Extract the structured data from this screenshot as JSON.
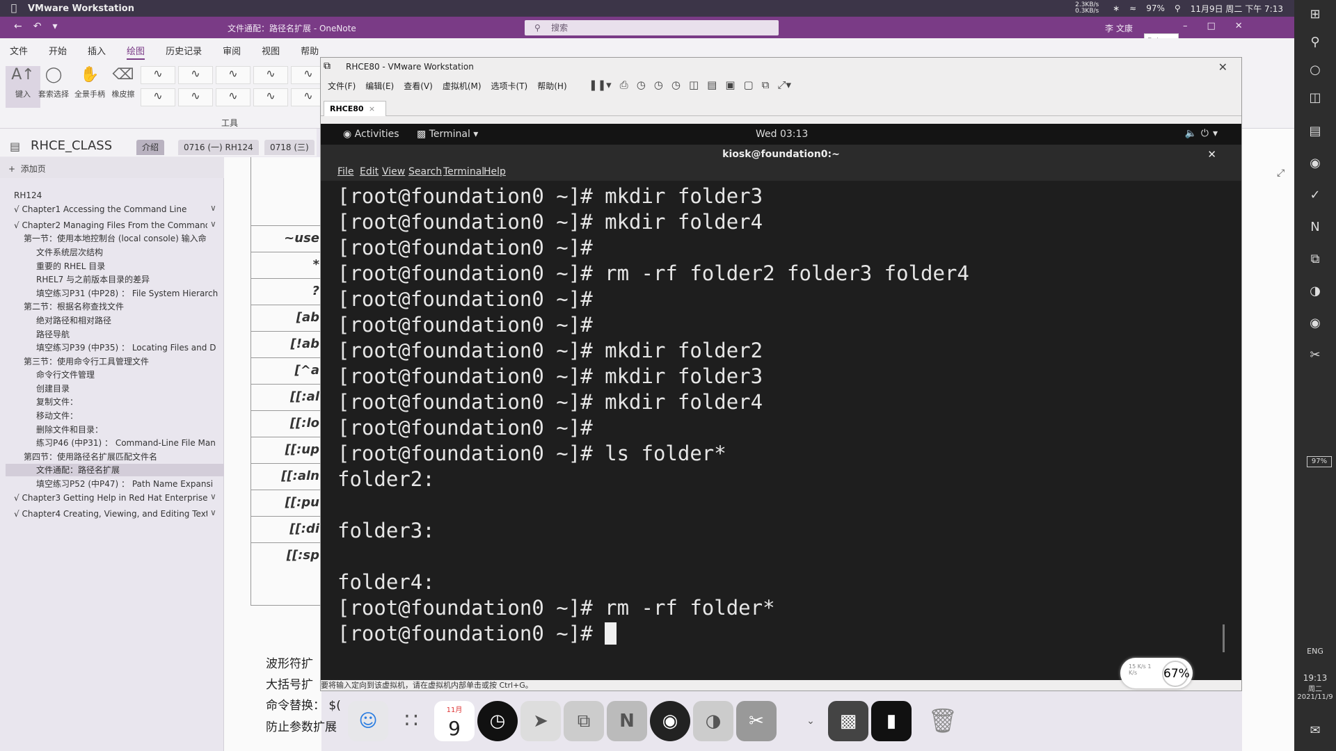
{
  "mac_menubar": {
    "app_name": "VMware Workstation",
    "right_items": [
      "2.3KB/s 0.3KB/s",
      "97%",
      "11月9日 周二 下午 7:13"
    ]
  },
  "onenote": {
    "window_title": "文件通配：路径名扩展 - OneNote",
    "search_placeholder": "搜索",
    "user": "李 文康",
    "ribbon_tabs": [
      "文件",
      "开始",
      "插入",
      "绘图",
      "历史记录",
      "审阅",
      "视图",
      "帮助"
    ],
    "active_tab": "绘图",
    "tools": [
      {
        "label": "键入",
        "icon": "cursor-icon"
      },
      {
        "label": "套索选择",
        "icon": "lasso-icon"
      },
      {
        "label": "全景手柄",
        "icon": "hand-icon"
      },
      {
        "label": "橡皮擦",
        "icon": "eraser-icon"
      }
    ],
    "tools_group_label": "工具",
    "notebook_name": "RHCE_CLASS",
    "sections": [
      "介绍",
      "0716 (一) RH124",
      "0718 (三)"
    ],
    "add_page": "添加页",
    "pages": [
      {
        "text": "RH124",
        "indent": 0
      },
      {
        "text": "√ Chapter1 Accessing the Command Line",
        "indent": 0,
        "chev": true
      },
      {
        "text": "√ Chapter2 Managing Files From the Command Li",
        "indent": 0,
        "chev": true
      },
      {
        "text": "第一节：使用本地控制台 (local console) 输入命",
        "indent": 1
      },
      {
        "text": "文件系统层次结构",
        "indent": 2
      },
      {
        "text": "重要的 RHEL 目录",
        "indent": 2
      },
      {
        "text": "RHEL7 与之前版本目录的差异",
        "indent": 2
      },
      {
        "text": "填空练习P31 (中P28) ： File System Hierarch",
        "indent": 2
      },
      {
        "text": "第二节：根据名称查找文件",
        "indent": 1
      },
      {
        "text": "绝对路径和相对路径",
        "indent": 2
      },
      {
        "text": "路径导航",
        "indent": 2
      },
      {
        "text": "填空练习P39 (中P35) ： Locating Files and D",
        "indent": 2
      },
      {
        "text": "第三节：使用命令行工具管理文件",
        "indent": 1
      },
      {
        "text": "命令行文件管理",
        "indent": 2
      },
      {
        "text": "创建目录",
        "indent": 2
      },
      {
        "text": "复制文件：",
        "indent": 2
      },
      {
        "text": "移动文件：",
        "indent": 2
      },
      {
        "text": "删除文件和目录：",
        "indent": 2
      },
      {
        "text": "练习P46 (中P31) ： Command-Line File Man",
        "indent": 2
      },
      {
        "text": "第四节：使用路径名扩展匹配文件名",
        "indent": 1
      },
      {
        "text": "文件通配：路径名扩展",
        "indent": 2,
        "selected": true
      },
      {
        "text": "填空练习P52 (中P47) ： Path Name Expansi",
        "indent": 2
      },
      {
        "text": "√ Chapter3 Getting Help in Red Hat Enterprise",
        "indent": 0,
        "chev": true
      },
      {
        "text": "√ Chapter4 Creating, Viewing, and Editing Text",
        "indent": 0,
        "chev": true
      }
    ],
    "table_cells": [
      "~use",
      "*",
      "?",
      "[ab",
      "[!ab",
      "[^a",
      "[[:al",
      "[[:lo",
      "[[:up",
      "[[:aln",
      "[[:pu",
      "[[:di",
      "[[:sp"
    ],
    "notes": [
      "波形符扩",
      "大括号扩",
      "命令替换：  $(",
      "防止参数扩展"
    ]
  },
  "popup": {
    "top_text": "Poi...",
    "button": "开始"
  },
  "vmware": {
    "title": "RHCE80 - VMware Workstation",
    "menu": [
      "文件(F)",
      "编辑(E)",
      "查看(V)",
      "虚拟机(M)",
      "选项卡(T)",
      "帮助(H)"
    ],
    "tab": "RHCE80",
    "status": "要将输入定向到该虚拟机，请在虚拟机内部单击或按 Ctrl+G。",
    "zoom": "67%",
    "net_speed": "15 K/s 1 K/s"
  },
  "guest": {
    "activities": "Activities",
    "app_menu": "Terminal",
    "clock": "Wed 03:13",
    "terminal_title": "kiosk@foundation0:~",
    "terminal_menu": [
      "File",
      "Edit",
      "View",
      "Search",
      "Terminal",
      "Help"
    ],
    "lines": [
      "[root@foundation0 ~]# mkdir folder3",
      "[root@foundation0 ~]# mkdir folder4",
      "[root@foundation0 ~]#",
      "[root@foundation0 ~]# rm -rf folder2 folder3 folder4",
      "[root@foundation0 ~]#",
      "[root@foundation0 ~]#",
      "[root@foundation0 ~]# mkdir folder2",
      "[root@foundation0 ~]# mkdir folder3",
      "[root@foundation0 ~]# mkdir folder4",
      "[root@foundation0 ~]#",
      "[root@foundation0 ~]# ls folder*",
      "folder2:",
      "",
      "folder3:",
      "",
      "folder4:",
      "[root@foundation0 ~]# rm -rf folder*"
    ],
    "prompt_line": "[root@foundation0 ~]# "
  },
  "dock": {
    "calendar_month": "11月",
    "calendar_day": "9",
    "apps": [
      "finder-icon",
      "launchpad-icon",
      "calendar-icon",
      "clock-icon",
      "feishu-icon",
      "vmware-icon",
      "onenote-icon",
      "obs-icon",
      "browser-icon",
      "screenshot-icon",
      "chevron-icon",
      "monitor-icon",
      "terminal-icon",
      "trash-icon"
    ]
  },
  "windows_bar": {
    "battery": "97%",
    "lang": "ENG",
    "time": "19:13",
    "date": "周二 2021/11/9"
  }
}
